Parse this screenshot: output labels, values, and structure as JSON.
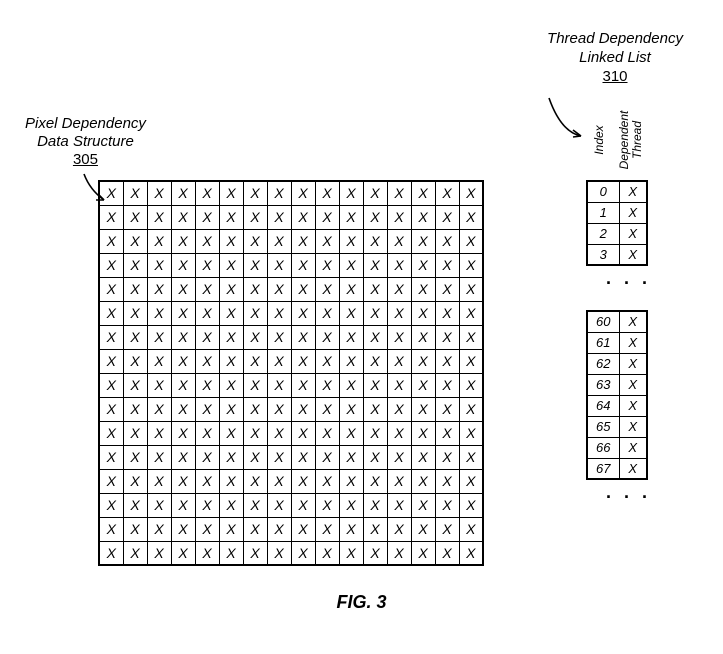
{
  "leftLabel": {
    "line1": "Pixel Dependency",
    "line2": "Data Structure",
    "ref": "305"
  },
  "rightTitle": {
    "line1": "Thread Dependency",
    "line2": "Linked List",
    "ref": "310"
  },
  "colHeaders": {
    "col1": "Index",
    "col2": "Dependent\nThread"
  },
  "grid": {
    "rows": 16,
    "cols": 16,
    "cell": "X"
  },
  "table1": [
    {
      "idx": "0",
      "val": "X"
    },
    {
      "idx": "1",
      "val": "X"
    },
    {
      "idx": "2",
      "val": "X"
    },
    {
      "idx": "3",
      "val": "X"
    }
  ],
  "table2": [
    {
      "idx": "60",
      "val": "X"
    },
    {
      "idx": "61",
      "val": "X"
    },
    {
      "idx": "62",
      "val": "X"
    },
    {
      "idx": "63",
      "val": "X"
    },
    {
      "idx": "64",
      "val": "X"
    },
    {
      "idx": "65",
      "val": "X"
    },
    {
      "idx": "66",
      "val": "X"
    },
    {
      "idx": "67",
      "val": "X"
    }
  ],
  "dots": ". . .",
  "figLabel": "FIG. 3"
}
